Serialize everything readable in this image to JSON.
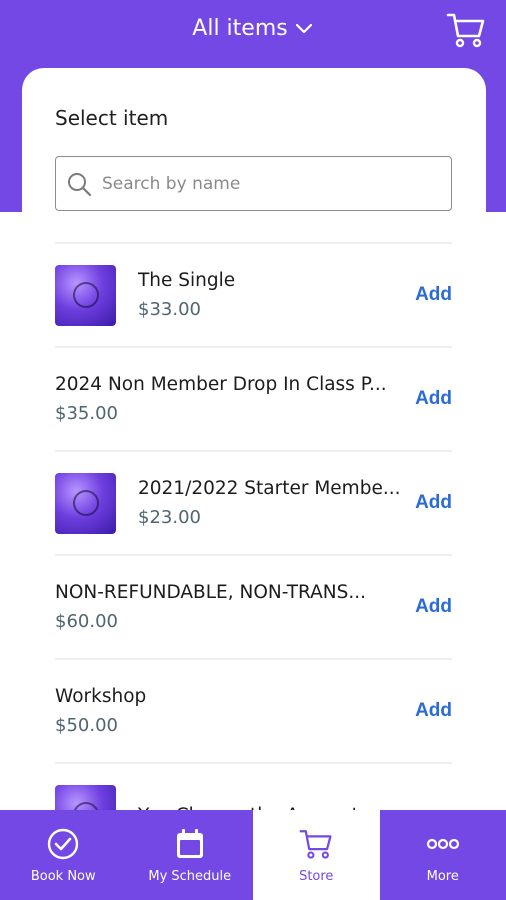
{
  "header": {
    "title": "All items",
    "cart_icon": "cart-icon",
    "chevron_icon": "chevron-down-icon"
  },
  "colors": {
    "brand": "#7448e4",
    "add_link": "#2a6bd8",
    "price": "#4f6671"
  },
  "select_item": {
    "title": "Select item",
    "search_placeholder": "Search by name",
    "search_value": ""
  },
  "items": [
    {
      "name": "The Single",
      "price": "$33.00",
      "action": "Add",
      "has_thumb": true
    },
    {
      "name": "2024 Non Member Drop In Class P...",
      "price": "$35.00",
      "action": "Add",
      "has_thumb": false
    },
    {
      "name": "2021/2022 Starter Membe...",
      "price": "$23.00",
      "action": "Add",
      "has_thumb": true
    },
    {
      "name": "NON-REFUNDABLE, NON-TRANS...",
      "price": "$60.00",
      "action": "Add",
      "has_thumb": false
    },
    {
      "name": "Workshop",
      "price": "$50.00",
      "action": "Add",
      "has_thumb": false
    },
    {
      "name": "You Choose the Amount",
      "price": "",
      "action": "",
      "has_thumb": true
    }
  ],
  "bottom_nav": [
    {
      "label": "Book Now",
      "icon": "check-circle-icon",
      "active": false
    },
    {
      "label": "My Schedule",
      "icon": "calendar-icon",
      "active": false
    },
    {
      "label": "Store",
      "icon": "cart-icon",
      "active": true
    },
    {
      "label": "More",
      "icon": "more-dots-icon",
      "active": false
    }
  ]
}
